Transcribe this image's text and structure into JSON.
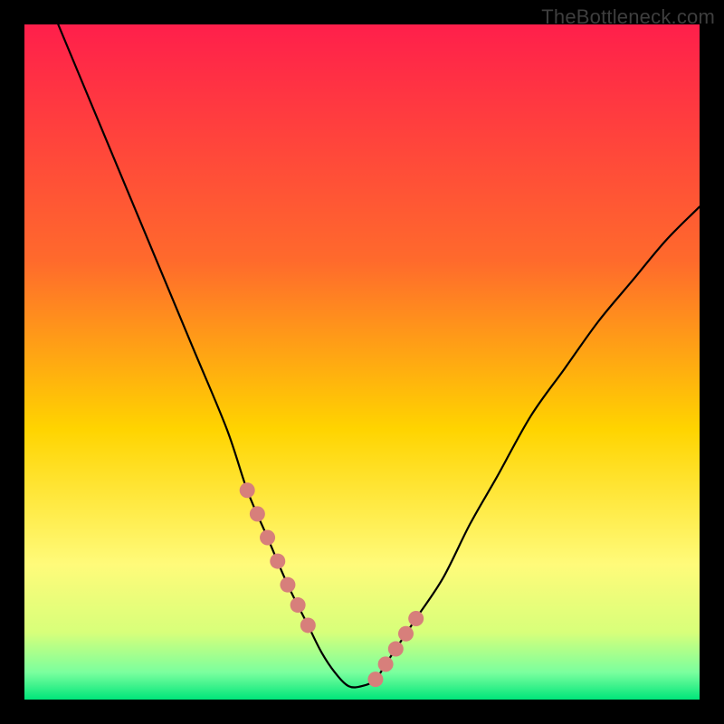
{
  "watermark": {
    "text": "TheBottleneck.com"
  },
  "chart_data": {
    "type": "line",
    "title": "",
    "xlabel": "",
    "ylabel": "",
    "xlim": [
      0,
      100
    ],
    "ylim": [
      0,
      100
    ],
    "series": [
      {
        "name": "bottleneck-curve",
        "x": [
          5,
          10,
          15,
          20,
          25,
          30,
          33,
          36,
          39,
          42,
          44,
          46,
          48,
          50,
          52,
          54,
          58,
          62,
          66,
          70,
          75,
          80,
          85,
          90,
          95,
          100
        ],
        "values": [
          100,
          88,
          76,
          64,
          52,
          40,
          31,
          24,
          17,
          11,
          7,
          4,
          2,
          2,
          3,
          6,
          12,
          18,
          26,
          33,
          42,
          49,
          56,
          62,
          68,
          73
        ]
      }
    ],
    "highlight_segments": [
      {
        "name": "left-flank-dots",
        "x_range": [
          33,
          42
        ]
      },
      {
        "name": "right-flank-dots",
        "x_range": [
          52,
          58
        ]
      }
    ],
    "gradient_stops": [
      {
        "pct": 0,
        "color": "#ff1f4b"
      },
      {
        "pct": 35,
        "color": "#ff6a2c"
      },
      {
        "pct": 60,
        "color": "#ffd400"
      },
      {
        "pct": 80,
        "color": "#fffb7a"
      },
      {
        "pct": 90,
        "color": "#d8ff7a"
      },
      {
        "pct": 96,
        "color": "#7aff9e"
      },
      {
        "pct": 100,
        "color": "#00e57a"
      }
    ]
  }
}
